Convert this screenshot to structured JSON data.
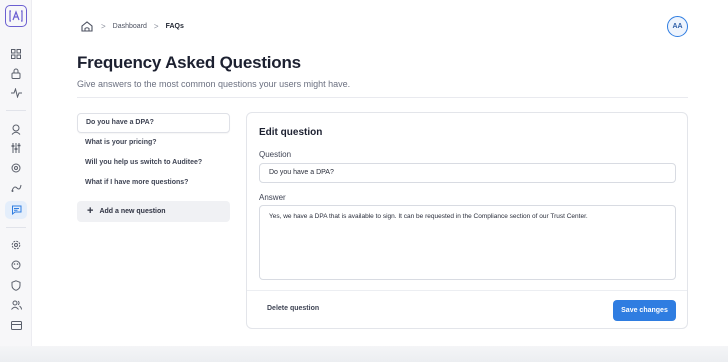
{
  "logo": {
    "text": "[A]"
  },
  "sidebar": {
    "icons": [
      {
        "name": "grid-icon",
        "glyph": "▦"
      },
      {
        "name": "lock-icon",
        "glyph": "⊡"
      },
      {
        "name": "activity-icon",
        "glyph": "∿"
      },
      {
        "name": "users-search-icon",
        "glyph": "⚲"
      },
      {
        "name": "sliders-icon",
        "glyph": "⫶"
      },
      {
        "name": "layers-icon",
        "glyph": "◎"
      },
      {
        "name": "route-icon",
        "glyph": "⤳"
      },
      {
        "name": "chat-icon",
        "glyph": "▤"
      },
      {
        "name": "settings-icon",
        "glyph": "⚙"
      },
      {
        "name": "palette-icon",
        "glyph": "◍"
      },
      {
        "name": "shield-icon",
        "glyph": "⛉"
      },
      {
        "name": "team-icon",
        "glyph": "⚇"
      },
      {
        "name": "billing-icon",
        "glyph": "▭"
      }
    ]
  },
  "breadcrumb": {
    "items": [
      "Dashboard",
      "FAQs"
    ],
    "separator": ">"
  },
  "user": {
    "initials": "AA"
  },
  "page": {
    "title": "Frequency Asked Questions",
    "subtitle": "Give answers to the most common questions your users might have."
  },
  "questions": [
    {
      "label": "Do you have a DPA?"
    },
    {
      "label": "What is your pricing?"
    },
    {
      "label": "Will you help us switch to Auditee?"
    },
    {
      "label": "What if I have more questions?"
    }
  ],
  "add_question_label": "Add a new question",
  "editor": {
    "title": "Edit question",
    "question_label": "Question",
    "question_value": "Do you have a DPA?",
    "answer_label": "Answer",
    "answer_value": "Yes, we have a DPA that is available to sign. It can be requested in the Compliance section of our Trust Center.",
    "delete_label": "Delete question",
    "save_label": "Save changes"
  },
  "colors": {
    "accent": "#2f7de1",
    "brand": "#6b5fd1"
  }
}
